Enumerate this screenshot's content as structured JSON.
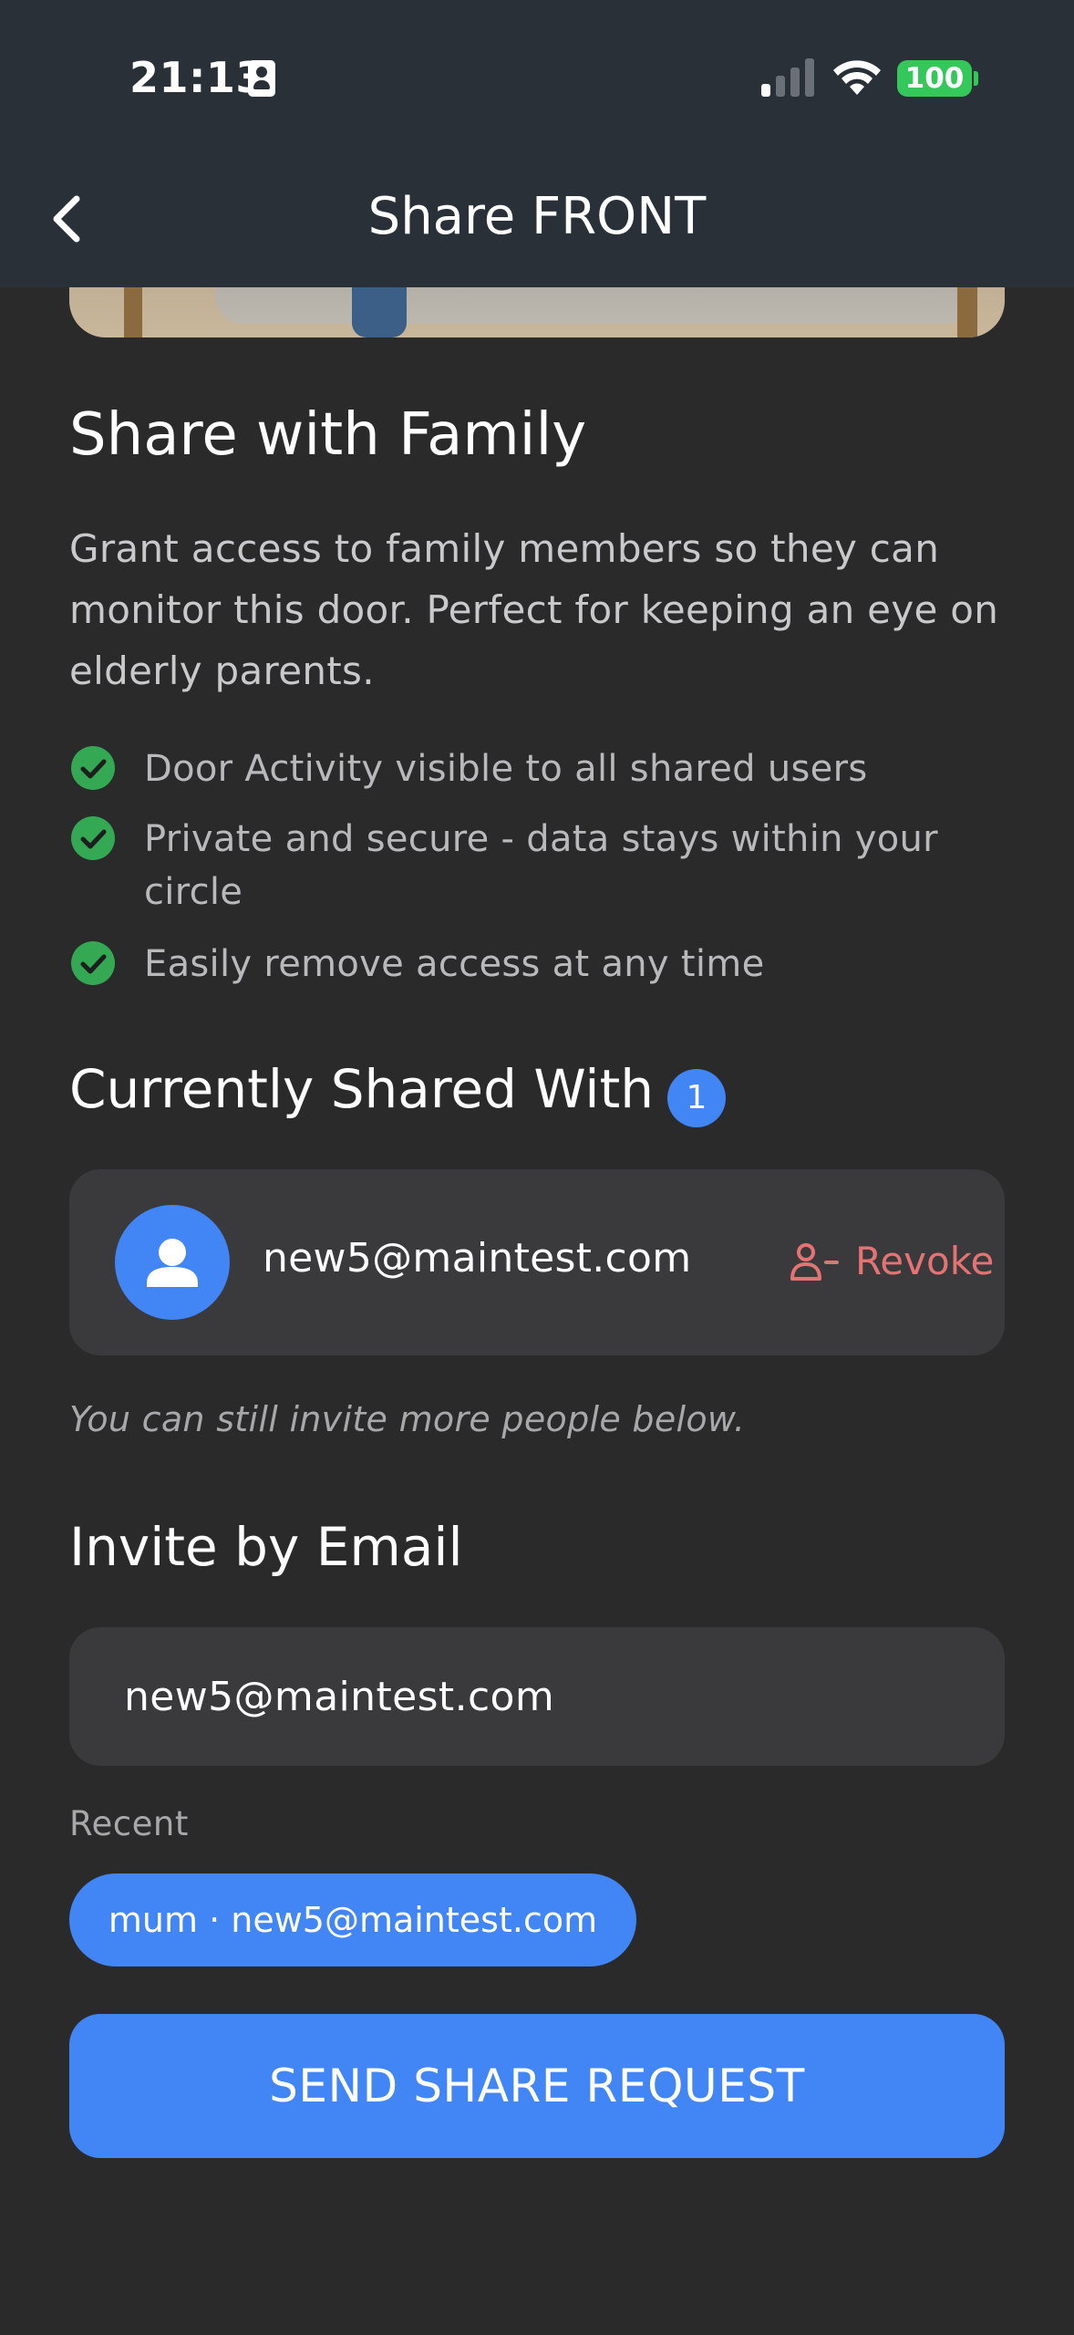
{
  "status_bar": {
    "time": "21:13",
    "battery": "100"
  },
  "nav": {
    "title": "Share FRONT",
    "back_icon": "chevron-left-icon"
  },
  "share_section": {
    "title": "Share with Family",
    "description": "Grant access to family members so they can monitor this door. Perfect for keeping an eye on elderly parents.",
    "features": [
      {
        "icon": "check-circle-icon",
        "text": "Door Activity visible to all shared users"
      },
      {
        "icon": "check-circle-icon",
        "text": "Private and secure - data stays within your circle"
      },
      {
        "icon": "check-circle-icon",
        "text": "Easily remove access at any time"
      }
    ]
  },
  "shared_with": {
    "title": "Currently Shared With",
    "count": "1",
    "users": [
      {
        "email": "new5@maintest.com",
        "action_label": "Revoke",
        "action_icon": "remove-user-icon"
      }
    ],
    "hint": "You can still invite more people below."
  },
  "invite": {
    "title": "Invite by Email",
    "email_value": "new5@maintest.com",
    "recent_label": "Recent",
    "recent_items": [
      {
        "label": "mum · new5@maintest.com"
      }
    ],
    "submit_label": "SEND SHARE REQUEST"
  },
  "colors": {
    "background": "#2a2a2b",
    "header": "#293038",
    "accent": "#4285f4",
    "success": "#34a853",
    "danger": "#e57373",
    "card": "#3a3a3c"
  }
}
